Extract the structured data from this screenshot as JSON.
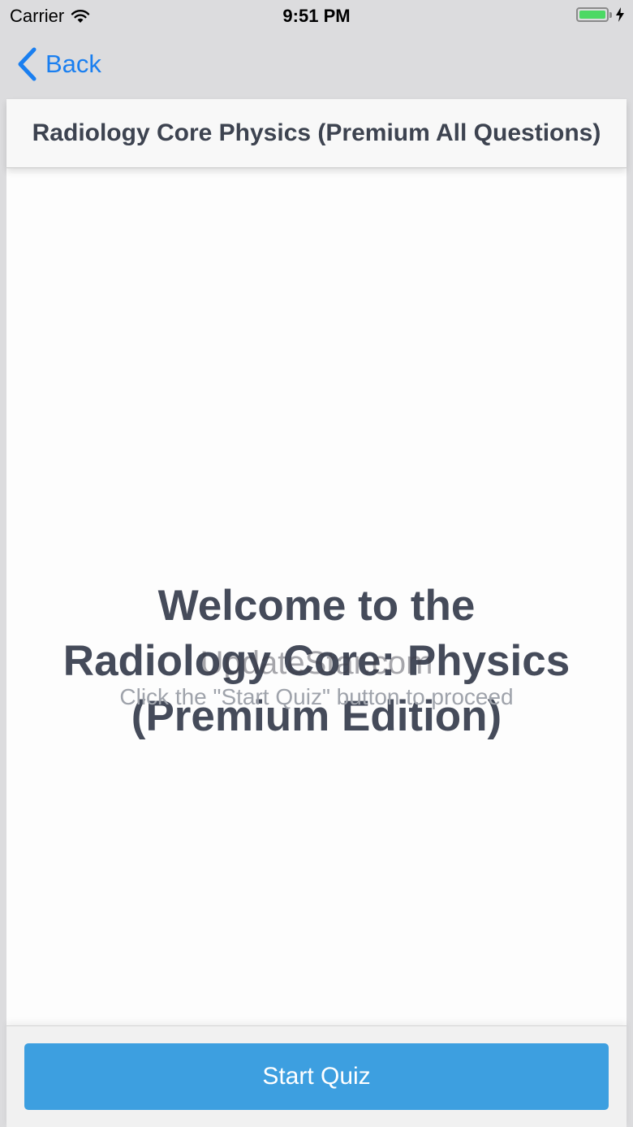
{
  "status_bar": {
    "carrier": "Carrier",
    "time": "9:51 PM",
    "battery_level": 1.0,
    "battery_color": "#4cd964"
  },
  "nav": {
    "back_label": "Back",
    "back_icon": "chevron-left-icon",
    "accent_color": "#1a7ff0"
  },
  "header": {
    "title": "Radiology Core Physics (Premium All Questions)"
  },
  "main": {
    "welcome_lines": [
      "Welcome to the",
      "Radiology Core: Physics",
      "(Premium Edition)"
    ],
    "instructions": "Click the \"Start Quiz\" button to proceed",
    "watermark": "UpdateStar.com"
  },
  "footer": {
    "start_label": "Start Quiz",
    "button_color": "#3d9fe0"
  }
}
